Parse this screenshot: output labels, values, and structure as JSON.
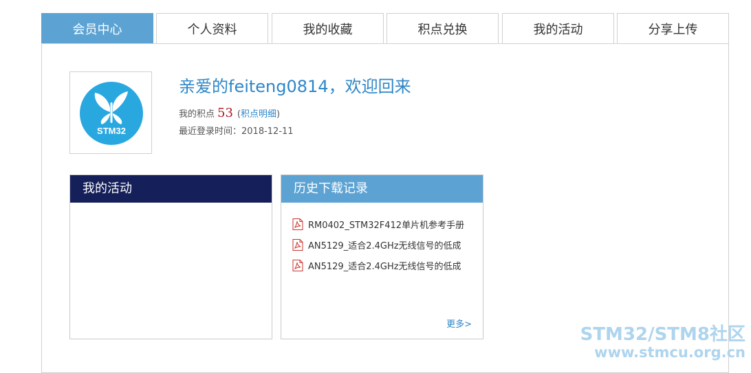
{
  "tabs": [
    {
      "label": "会员中心",
      "active": true
    },
    {
      "label": "个人资料",
      "active": false
    },
    {
      "label": "我的收藏",
      "active": false
    },
    {
      "label": "积点兑换",
      "active": false
    },
    {
      "label": "我的活动",
      "active": false
    },
    {
      "label": "分享上传",
      "active": false
    }
  ],
  "profile": {
    "avatar_text": "STM32",
    "welcome": "亲爱的feiteng0814，欢迎回来",
    "points_label": "我的积点",
    "points_value": "53",
    "points_link_open": "(",
    "points_link": "积点明细",
    "points_link_close": ")",
    "last_login": "最近登录时间：2018-12-11"
  },
  "activity_box": {
    "title": "我的活动"
  },
  "history_box": {
    "title": "历史下载记录",
    "items": [
      "RM0402_STM32F412单片机参考手册",
      "AN5129_适合2.4GHz无线信号的低成",
      "AN5129_适合2.4GHz无线信号的低成"
    ],
    "more": "更多>"
  },
  "watermark": {
    "line1": "STM32/STM8社区",
    "line2": "www.stmcu.org.cn"
  },
  "colors": {
    "tab_active": "#5ca3d4",
    "activity_header": "#15205a",
    "history_header": "#5ca3d4",
    "welcome": "#2c86c8",
    "points": "#b3141e",
    "avatar_circle": "#29a8e0",
    "watermark": "#aed4ee"
  },
  "icons": {
    "download_item": "pdf-file-icon",
    "avatar": "stm32-butterfly-logo"
  }
}
